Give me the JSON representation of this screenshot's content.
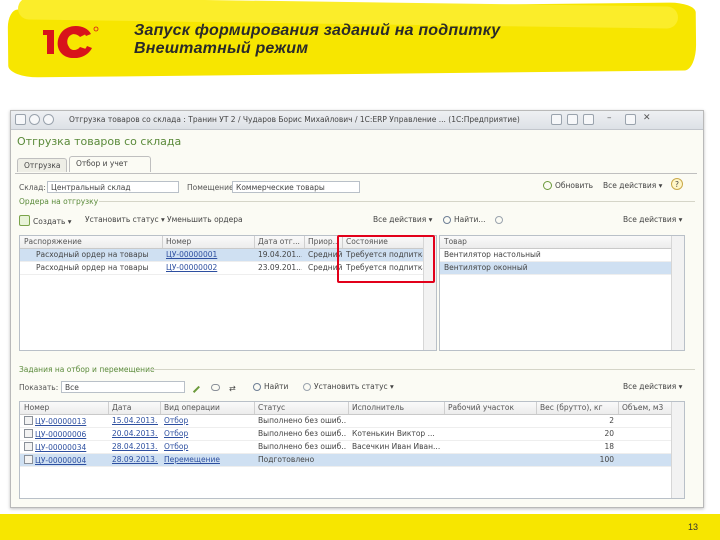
{
  "slide": {
    "logo_text": "1С",
    "title_line1": "Запуск формирования заданий на подпитку",
    "title_line2": "Внештатный режим",
    "page_number": "13"
  },
  "window": {
    "title": "Отгрузка товаров со склада : Транин УТ 2 / Чударов Борис Михайлович / 1С:ERP Управление ...  (1С:Предприятие)",
    "form_title": "Отгрузка товаров со склада",
    "tabs": [
      "Отгрузка",
      "Отбор и учет"
    ],
    "filters": {
      "warehouse_label": "Склад:",
      "warehouse_value": "Центральный склад",
      "premises_label": "Помещение:",
      "premises_value": "Коммерческие товары",
      "refresh_label": "Обновить",
      "all_actions": "Все действия"
    },
    "orders_group": "Ордера на отгрузку",
    "orders_toolbar": {
      "create": "Создать",
      "set_status": "Установить статус",
      "decrease_order": "Уменьшить ордера",
      "all_actions": "Все действия",
      "find": "Найти...",
      "all_actions_right": "Все действия"
    },
    "orders_columns": [
      "Распоряжение",
      "Номер",
      "Дата отг...",
      "Приор...",
      "Состояние"
    ],
    "orders_rows": [
      {
        "order": "Расходный ордер на товары",
        "number": "ЦУ-00000001",
        "date": "19.04.201...",
        "priority": "Средний",
        "state": "Требуется подпитка"
      },
      {
        "order": "Расходный ордер на товары",
        "number": "ЦУ-00000002",
        "date": "23.09.201...",
        "priority": "Средний",
        "state": "Требуется подпитка"
      }
    ],
    "goods_column": "Товар",
    "goods_rows": [
      "Вентилятор настольный",
      "Вентилятор оконный"
    ],
    "tasks_group": "Задания на отбор и перемещение",
    "tasks_toolbar": {
      "show_label": "Показать:",
      "show_value": "Все",
      "find": "Найти",
      "set_status": "Установить статус",
      "all_actions": "Все действия"
    },
    "tasks_columns": [
      "Номер",
      "Дата",
      "Вид операции",
      "Статус",
      "Исполнитель",
      "Рабочий участок",
      "Вес (брутто), кг",
      "Объем, м3"
    ],
    "tasks_rows": [
      {
        "number": "ЦУ-00000013",
        "date": "15.04.2013...",
        "op": "Отбор",
        "status": "Выполнено без ошиб...",
        "executor": "",
        "area": "",
        "weight": "2",
        "volume": ""
      },
      {
        "number": "ЦУ-00000006",
        "date": "20.04.2013...",
        "op": "Отбор",
        "status": "Выполнено без ошиб...",
        "executor": "Котенькин Виктор ...",
        "area": "",
        "weight": "20",
        "volume": ""
      },
      {
        "number": "ЦУ-00000034",
        "date": "28.04.2013...",
        "op": "Отбор",
        "status": "Выполнено без ошиб...",
        "executor": "Васечкин Иван Иван...",
        "area": "",
        "weight": "18",
        "volume": ""
      },
      {
        "number": "ЦУ-00000004",
        "date": "28.09.2013...",
        "op": "Перемещение",
        "status": "Подготовлено",
        "executor": "",
        "area": "",
        "weight": "100",
        "volume": ""
      }
    ]
  },
  "colors": {
    "brand_yellow": "#f7e600",
    "logo_red": "#d8131b",
    "highlight_red": "#e2001a",
    "selection_blue": "#cfe0f2",
    "group_green": "#5a8a3a"
  }
}
